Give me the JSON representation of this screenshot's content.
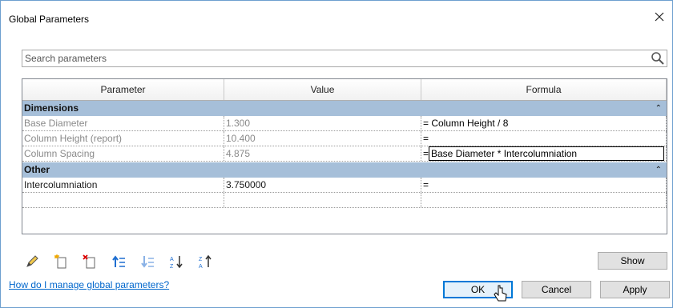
{
  "window": {
    "title": "Global Parameters"
  },
  "search": {
    "placeholder": "Search parameters"
  },
  "grid": {
    "columns": [
      "Parameter",
      "Value",
      "Formula"
    ],
    "groups": [
      {
        "name": "Dimensions",
        "rows": [
          {
            "parameter": "Base Diameter",
            "value": "1.300",
            "formula": "= Column Height / 8",
            "readonly": true
          },
          {
            "parameter": "Column Height (report)",
            "value": "10.400",
            "formula": "=",
            "readonly": true
          },
          {
            "parameter": "Column Spacing",
            "value": "4.875",
            "formula_prefix": "=",
            "formula": "Base Diameter * Intercolumniation",
            "readonly": true,
            "editing": true
          }
        ]
      },
      {
        "name": "Other",
        "rows": [
          {
            "parameter": "Intercolumniation",
            "value": "3.750000",
            "formula": "=",
            "readonly": false
          }
        ]
      }
    ]
  },
  "toolbar": {
    "icons": [
      "edit-pencil-icon",
      "new-parameter-icon",
      "delete-parameter-icon",
      "move-up-icon",
      "move-down-icon",
      "sort-ascending-icon",
      "sort-descending-icon"
    ]
  },
  "buttons": {
    "show": "Show",
    "ok": "OK",
    "cancel": "Cancel",
    "apply": "Apply"
  },
  "help_link": "How do I manage global parameters?",
  "colors": {
    "group_header": "#a6bfd9",
    "link": "#0066cc",
    "focus_border": "#0078d7"
  }
}
